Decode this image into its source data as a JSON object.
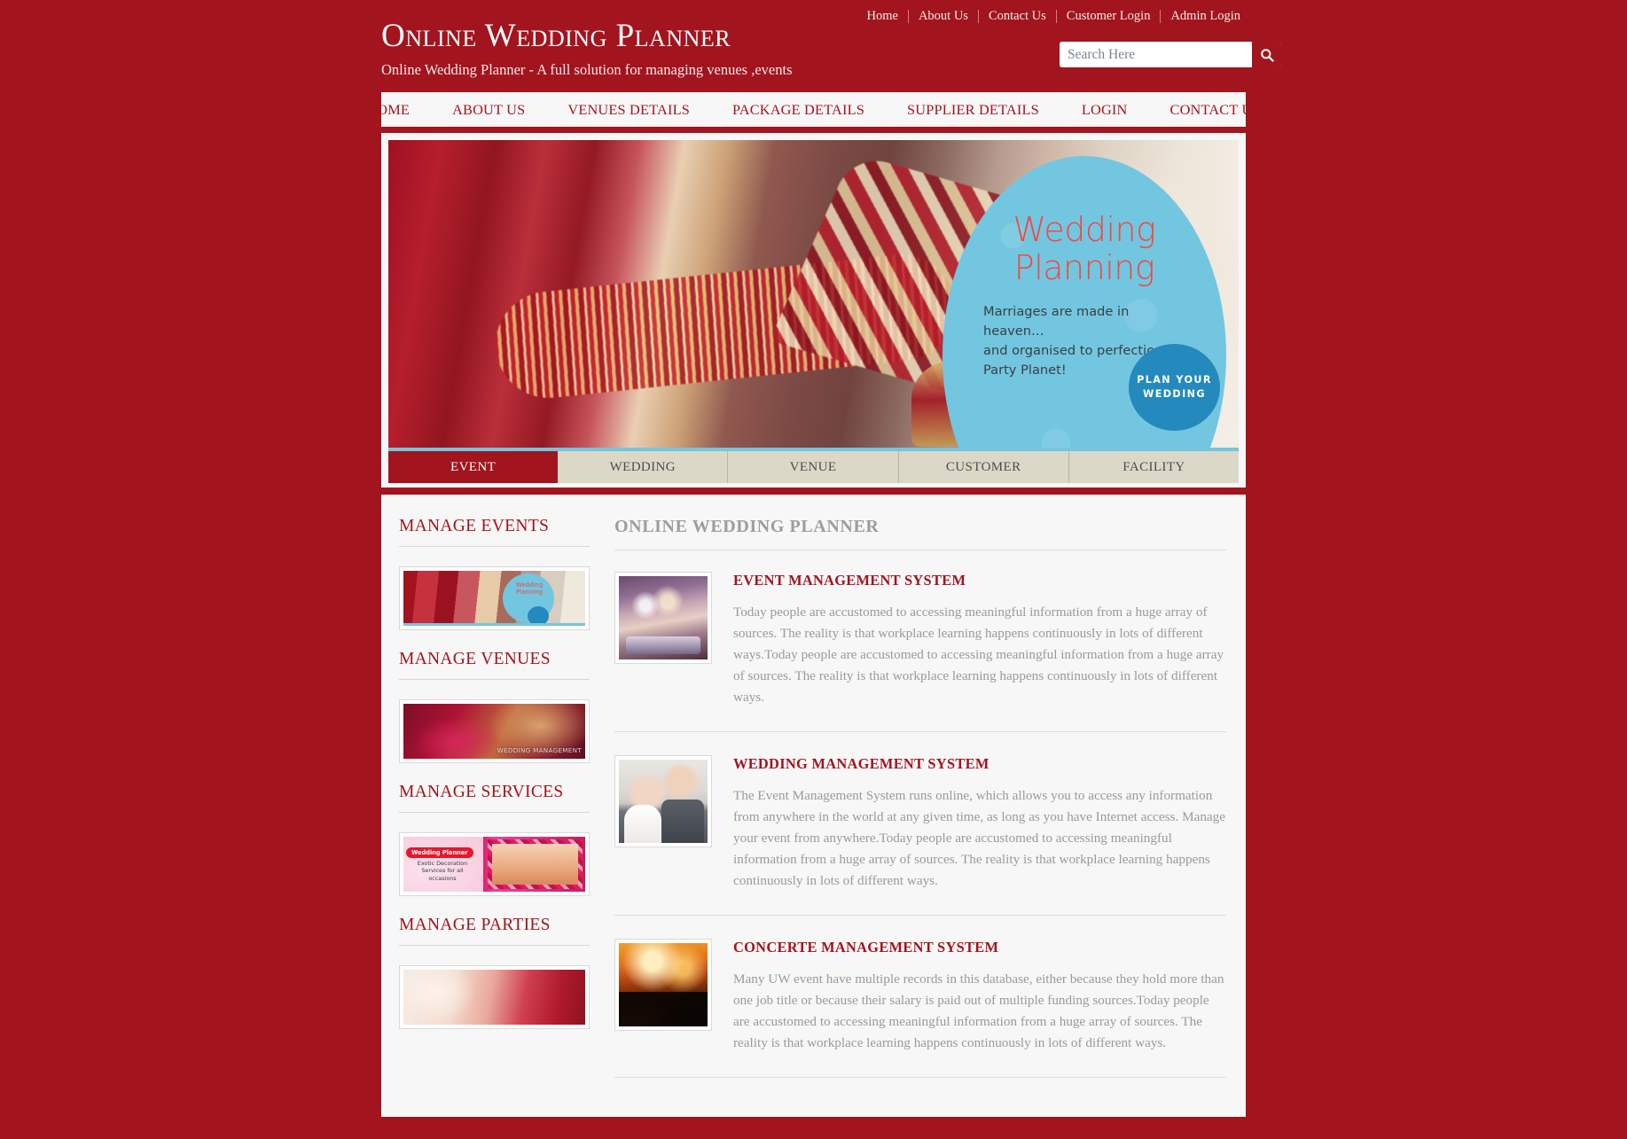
{
  "brand": {
    "title": "Online Wedding Planner",
    "tagline": "Online Wedding Planner - A full solution for managing venues ,events"
  },
  "util_nav": {
    "items": [
      {
        "label": "Home"
      },
      {
        "label": "About Us"
      },
      {
        "label": "Contact Us"
      },
      {
        "label": "Customer Login"
      },
      {
        "label": "Admin Login"
      }
    ]
  },
  "search": {
    "placeholder": "Search Here",
    "value": "",
    "icon": "search-icon"
  },
  "main_nav": {
    "items": [
      {
        "label": "HOME"
      },
      {
        "label": "ABOUT US"
      },
      {
        "label": "VENUES DETAILS"
      },
      {
        "label": "PACKAGE DETAILS"
      },
      {
        "label": "SUPPLIER DETAILS"
      },
      {
        "label": "LOGIN"
      },
      {
        "label": "CONTACT US"
      }
    ]
  },
  "hero": {
    "headline": "Wedding\nPlanning",
    "headline_line1": "Wedding",
    "headline_line2": "Planning",
    "subtext": "Marriages are made in heaven…\nand organised to perfection by\nParty Planet!",
    "badge_label": "PLAN YOUR WEDDING",
    "accent_color": "#73c6e0",
    "badge_color": "#2489bd",
    "headline_color": "#ef4a43"
  },
  "tabs": {
    "items": [
      {
        "label": "EVENT",
        "active": true
      },
      {
        "label": "WEDDING",
        "active": false
      },
      {
        "label": "VENUE",
        "active": false
      },
      {
        "label": "CUSTOMER",
        "active": false
      },
      {
        "label": "FACILITY",
        "active": false
      }
    ],
    "active_color": "#A2141E",
    "inactive_color": "#DCD8C8"
  },
  "sidebar": {
    "sections": [
      {
        "heading": "MANAGE EVENTS",
        "thumb_caption": "Wedding Planning"
      },
      {
        "heading": "MANAGE VENUES",
        "thumb_caption": "WEDDING MANAGEMENT"
      },
      {
        "heading": "MANAGE SERVICES",
        "thumb_tag": "Wedding Planner",
        "thumb_caption": "Exotic Decoration Services for all occasions"
      },
      {
        "heading": "MANAGE PARTIES",
        "thumb_caption": ""
      }
    ]
  },
  "main": {
    "title": "ONLINE WEDDING PLANNER",
    "posts": [
      {
        "title": "EVENT MANAGEMENT SYSTEM",
        "text": "Today people are accustomed to accessing meaningful information from a huge array of sources. The reality is that workplace learning happens continuously in lots of different ways.Today people are accustomed to accessing meaningful information from a huge array of sources. The reality is that workplace learning happens continuously in lots of different ways.",
        "thumb": "champagne-glasses-image"
      },
      {
        "title": "WEDDING MANAGEMENT SYSTEM",
        "text": "The Event Management System runs online, which allows you to access any information from anywhere in the world at any given time, as long as you have Internet access. Manage your event from anywhere.Today people are accustomed to accessing meaningful information from a huge array of sources. The reality is that workplace learning happens continuously in lots of different ways.",
        "thumb": "wedding-couple-image"
      },
      {
        "title": "CONCERTE MANAGEMENT SYSTEM",
        "text": "Many UW event have multiple records in this database, either because they hold more than one job title or because their salary is paid out of multiple funding sources.Today people are accustomed to accessing meaningful information from a huge array of sources. The reality is that workplace learning happens continuously in lots of different ways.",
        "thumb": "concert-crowd-image"
      }
    ]
  },
  "theme": {
    "brand_red": "#A2141E",
    "panel_bg": "#F7F7F7",
    "muted_text": "#9a9a9a"
  }
}
